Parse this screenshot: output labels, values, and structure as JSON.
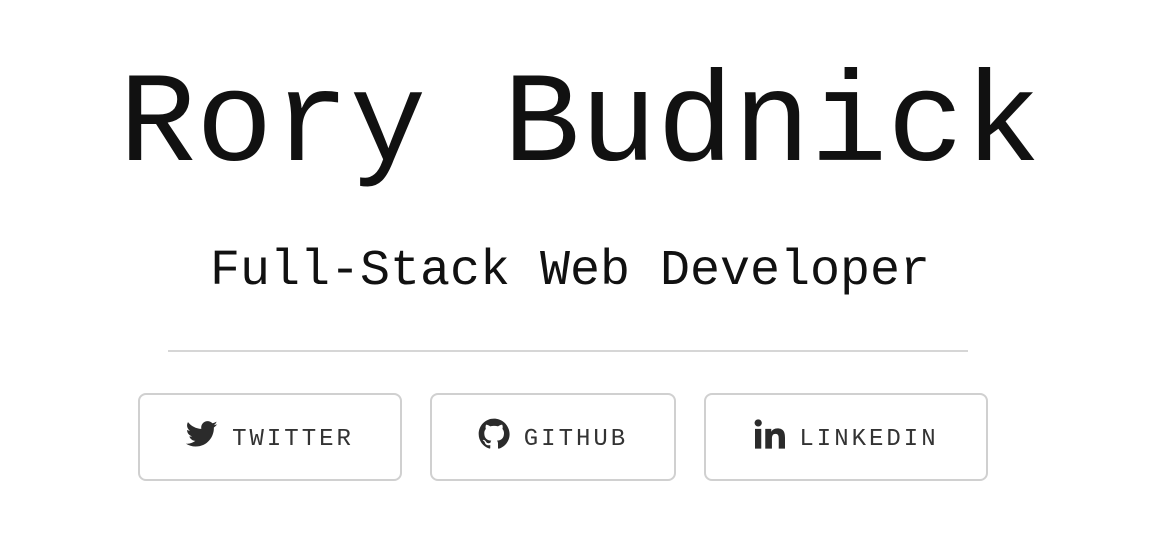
{
  "header": {
    "name": "Rory Budnick",
    "subtitle": "Full-Stack Web Developer"
  },
  "social_links": [
    {
      "label": "TWITTER",
      "icon": "twitter-icon"
    },
    {
      "label": "GITHUB",
      "icon": "github-icon"
    },
    {
      "label": "LINKEDIN",
      "icon": "linkedin-icon"
    }
  ],
  "colors": {
    "text": "#111111",
    "button_border": "#d0d0d0",
    "divider": "#d6d6d6"
  }
}
